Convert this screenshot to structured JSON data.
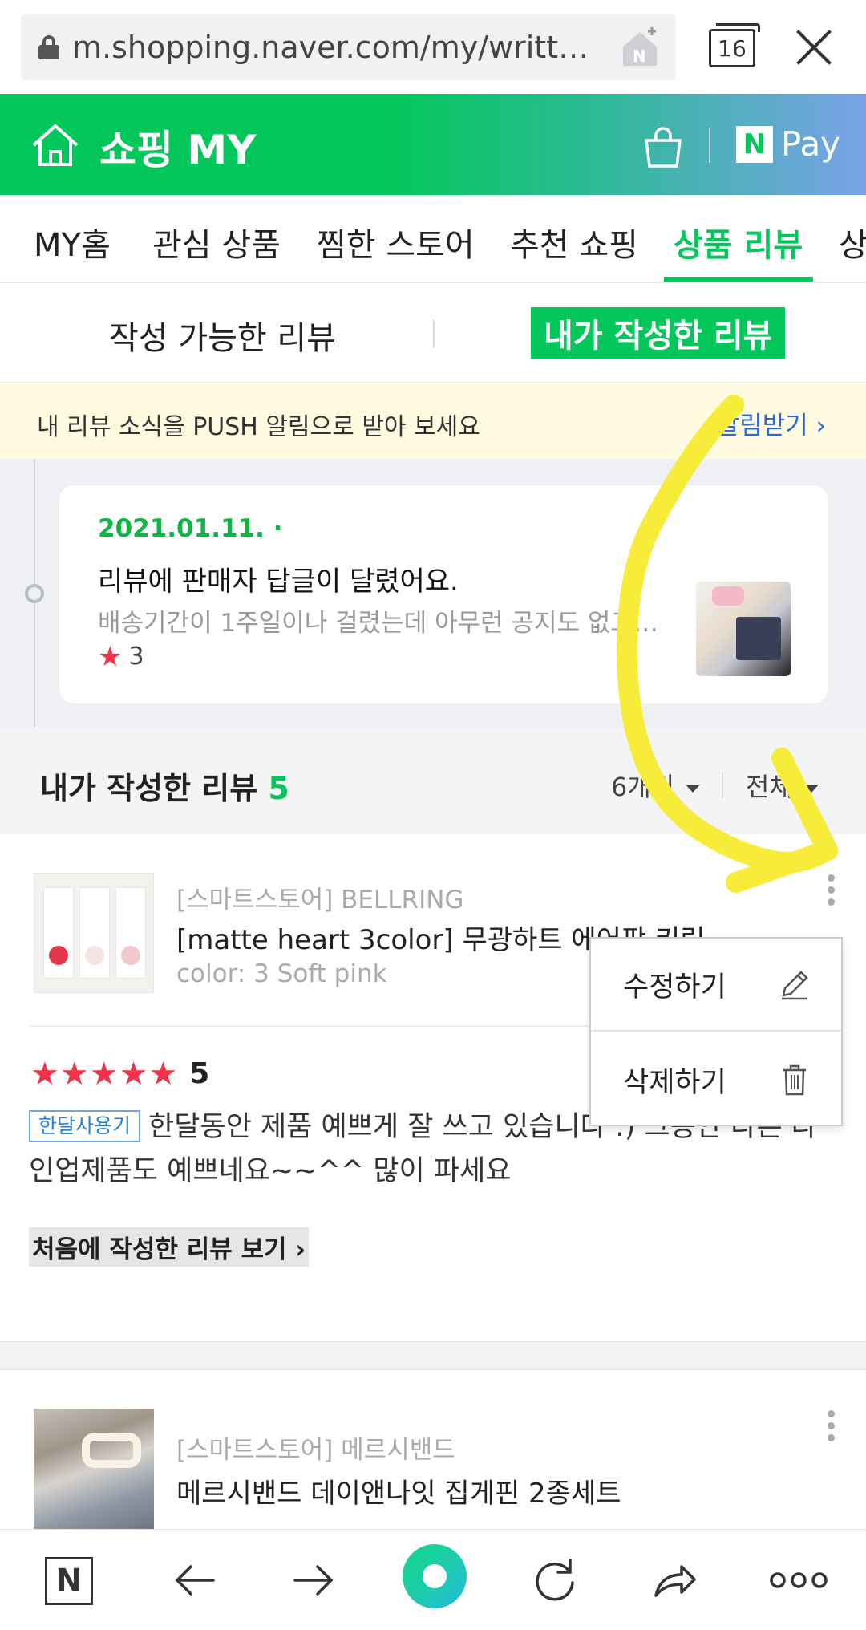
{
  "browser": {
    "url": "m.shopping.naver.com/my/writte…",
    "tab_count": "16"
  },
  "header": {
    "title": "쇼핑 MY",
    "pay_n": "N",
    "pay_label": "Pay"
  },
  "nav": {
    "tabs": [
      {
        "label": "MY홈"
      },
      {
        "label": "관심 상품"
      },
      {
        "label": "찜한 스토어"
      },
      {
        "label": "추천 쇼핑"
      },
      {
        "label": "상품 리뷰"
      },
      {
        "label": "상"
      }
    ],
    "active_index": 4
  },
  "subtabs": {
    "available": "작성 가능한 리뷰",
    "written": "내가 작성한 리뷰"
  },
  "push_banner": {
    "text": "내 리뷰 소식을 PUSH 알림으로 받아 보세요",
    "link": "알림받기 ›"
  },
  "notification": {
    "date": "2021.01.11. ·",
    "title": "리뷰에 판매자 답글이 달렸어요.",
    "body": "배송기간이 1주일이나 걸렸는데 아무런 공지도 없고…",
    "rating": "3"
  },
  "section": {
    "title": "내가 작성한 리뷰",
    "count": "5",
    "filter_period": "6개월",
    "filter_type": "전체"
  },
  "reviews": [
    {
      "store": "[스마트스토어] BELLRING",
      "product": "[matte heart 3color] 무광하트 에어팟 키링 벨…",
      "option": "color: 3 Soft pink",
      "rating": "5",
      "badge": "한달사용기",
      "text": "한달동안 제품 예쁘게 잘 쓰고 있습니다 :) 그동안 다른 라인업제품도 예쁘네요~~^^ 많이 파세요",
      "first_review_link": "처음에 작성한 리뷰 보기 ›"
    },
    {
      "store": "[스마트스토어] 메르시밴드",
      "product": "메르시밴드 데이앤나잇 집게핀 2종세트"
    }
  ],
  "context_menu": {
    "edit": "수정하기",
    "delete": "삭제하기"
  },
  "colors": {
    "brand_green": "#03c75a",
    "star_red": "#f1334a",
    "annotation_yellow": "#f7ec3a"
  },
  "icons": [
    "lock-icon",
    "naver-home-icon",
    "tabs-icon",
    "close-icon",
    "home-icon",
    "shopping-bag-icon",
    "star-icon",
    "more-vert-icon",
    "pencil-icon",
    "trash-icon",
    "back-icon",
    "forward-icon",
    "reload-icon",
    "share-icon",
    "more-horiz-icon"
  ]
}
